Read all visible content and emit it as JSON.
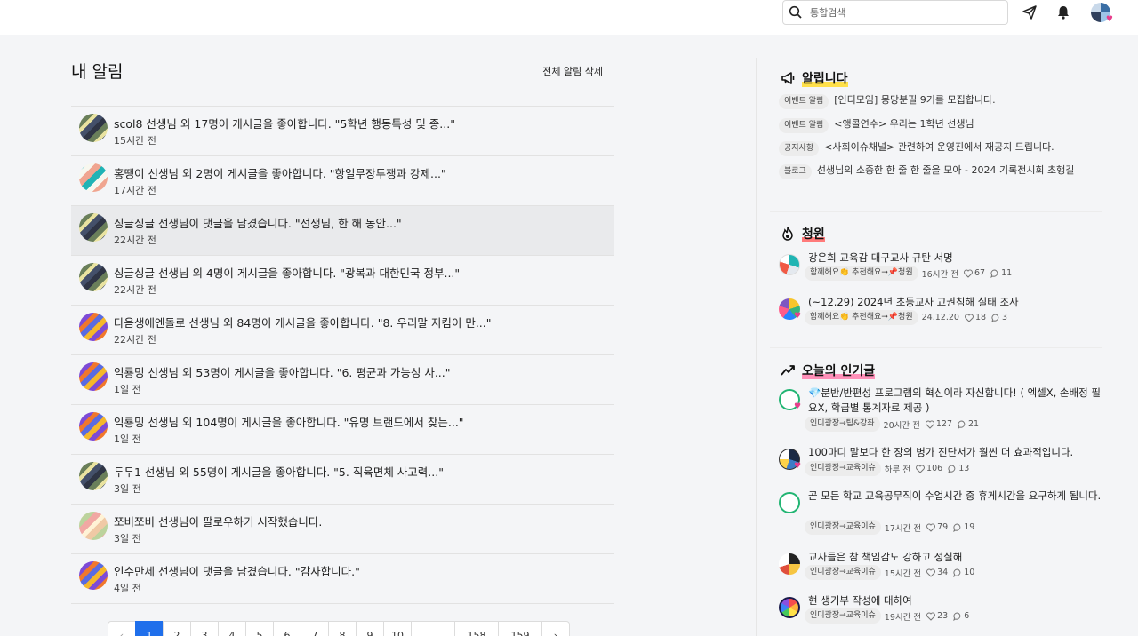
{
  "header": {
    "search_placeholder": "통합검색",
    "icons": [
      "search-icon",
      "send-icon",
      "bell-icon",
      "avatar"
    ]
  },
  "main": {
    "title": "내 알림",
    "delete_all": "전체 알림 삭제",
    "notifications": [
      {
        "message": "scol8 선생님 외 17명이 게시글을 좋아합니다. \"5학년 행동특성 및 종...\"",
        "time": "15시간 전"
      },
      {
        "message": "홍땡이 선생님 외 2명이 게시글을 좋아합니다. \"항일무장투쟁과 강제...\"",
        "time": "17시간 전"
      },
      {
        "message": "싱글싱글 선생님이 댓글을 남겼습니다. \"선생님, 한 해 동안...\"",
        "time": "22시간 전"
      },
      {
        "message": "싱글싱글 선생님 외 4명이 게시글을 좋아합니다. \"광복과 대한민국 정부...\"",
        "time": "22시간 전"
      },
      {
        "message": "다음생애엔돌로 선생님 외 84명이 게시글을 좋아합니다. \"8. 우리말 지킴이 만...\"",
        "time": "22시간 전"
      },
      {
        "message": "익룡밍 선생님 외 53명이 게시글을 좋아합니다. \"6. 평균과 가능성 사...\"",
        "time": "1일 전"
      },
      {
        "message": "익룡밍 선생님 외 104명이 게시글을 좋아합니다. \"유명 브랜드에서 찾는...\"",
        "time": "1일 전"
      },
      {
        "message": "두두1 선생님 외 55명이 게시글을 좋아합니다. \"5. 직육면체 사고력...\"",
        "time": "3일 전"
      },
      {
        "message": "쪼비쪼비 선생님이 팔로우하기 시작했습니다.",
        "time": "3일 전"
      },
      {
        "message": "인수만세 선생님이 댓글을 남겼습니다. \"감사합니다.\"",
        "time": "4일 전"
      }
    ],
    "pagination": {
      "prev": "‹",
      "pages": [
        "1",
        "2",
        "3",
        "4",
        "5",
        "6",
        "7",
        "8",
        "9",
        "10",
        "…",
        "158",
        "159"
      ],
      "next": "›",
      "current": "1"
    }
  },
  "side": {
    "notice": {
      "title": "알립니다",
      "items": [
        {
          "tag": "이벤트 알림",
          "text": "[인디모임] 몽당분필 9기를 모집합니다."
        },
        {
          "tag": "이벤트 알림",
          "text": "<앵콜연수> 우리는 1학년 선생님"
        },
        {
          "tag": "공지사항",
          "text": "<사회이슈채널> 관련하여 운영진에서 재공지 드립니다."
        },
        {
          "tag": "블로그",
          "text": "선생님의 소중한 한 줄 한 줄을 모아 - 2024 기록전시회 초행길"
        }
      ]
    },
    "petition": {
      "title": "청원",
      "items": [
        {
          "title": "강은희 교육감 대구교사 규탄 서명",
          "tag": "함께해요👏 추천해요→📌청원",
          "time": "16시간 전",
          "likes": "67",
          "comments": "11"
        },
        {
          "title": "(~12.29) 2024년 초등교사 교권침해 실태 조사",
          "tag": "함께해요👏 추천해요→📌청원",
          "time": "24.12.20",
          "likes": "18",
          "comments": "3"
        }
      ]
    },
    "popular": {
      "title": "오늘의 인기글",
      "items": [
        {
          "title": "💎분반/반편성 프로그램의 혁신이라 자신합니다! ( 엑셀X, 손배정 필요X, 학급별 통계자료 제공 )",
          "tag": "인디광장→팁&강좌",
          "time": "20시간 전",
          "likes": "127",
          "comments": "21"
        },
        {
          "title": "100마디 말보다 한 장의 병가 진단서가 훨씬 더 효과적입니다.",
          "tag": "인디광장→교육이슈",
          "time": "하루 전",
          "likes": "106",
          "comments": "13"
        },
        {
          "title": "곧 모든 학교 교육공무직이 수업시간 중 휴게시간을 요구하게 됩니다.",
          "tag": "인디광장→교육이슈",
          "time": "17시간 전",
          "likes": "79",
          "comments": "19"
        },
        {
          "title": "교사들은 참 책임감도 강하고 성실해",
          "tag": "인디광장→교육이슈",
          "time": "15시간 전",
          "likes": "34",
          "comments": "10"
        },
        {
          "title": "현 생기부 작성에 대하여",
          "tag": "인디광장→교육이슈",
          "time": "19시간 전",
          "likes": "23",
          "comments": "6"
        }
      ]
    }
  }
}
